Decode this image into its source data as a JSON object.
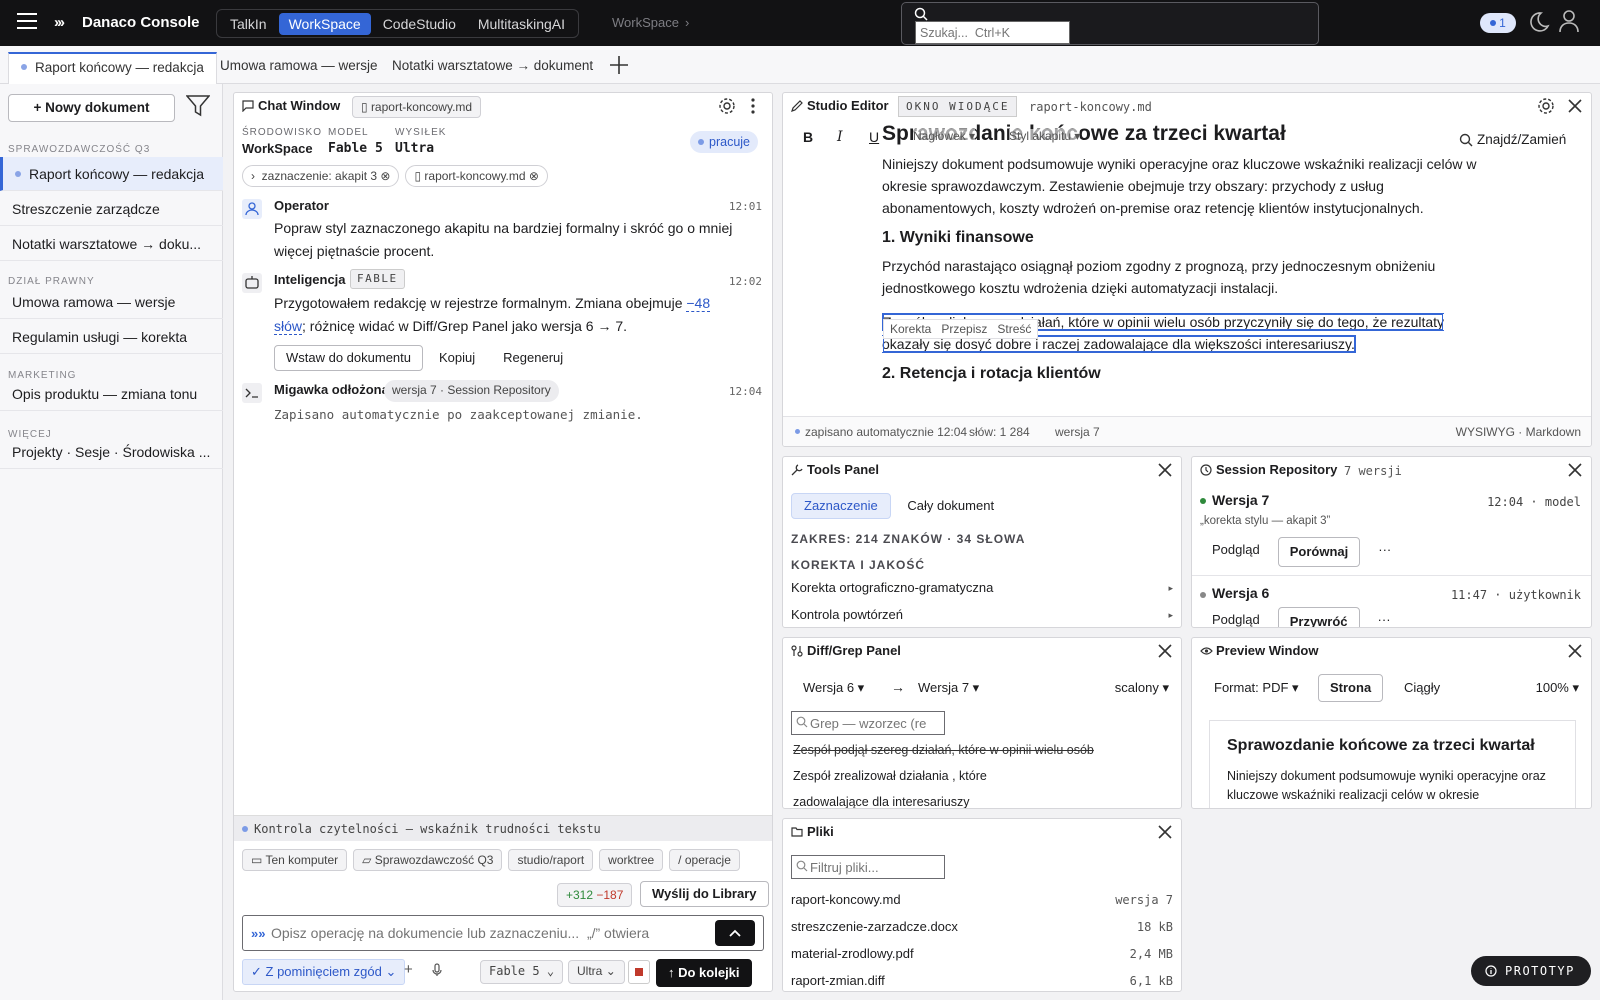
{
  "topbar": {
    "brand": "Danaco Console",
    "apps": [
      "TalkIn",
      "WorkSpace",
      "CodeStudio",
      "MultitaskingAI"
    ],
    "breadcrumb": "WorkSpace",
    "search_placeholder": "Szukaj...  Ctrl+K",
    "notif_count": "1"
  },
  "doc_tabs": [
    "Raport końcowy — redakcja",
    "Umowa ramowa — wersje",
    "Notatki warsztatowe → dokument"
  ],
  "sidebar": {
    "new_doc": "+ Nowy dokument",
    "sections": [
      {
        "title": "SPRAWOZDAWCZOŚĆ Q3",
        "items": [
          "Raport końcowy — redakcja",
          "Streszczenie zarządcze",
          "Notatki warsztatowe → doku..."
        ]
      },
      {
        "title": "DZIAŁ PRAWNY",
        "items": [
          "Umowa ramowa — wersje",
          "Regulamin usługi — korekta"
        ]
      },
      {
        "title": "MARKETING",
        "items": [
          "Opis produktu — zmiana tonu"
        ]
      },
      {
        "title": "WIĘCEJ",
        "items": [
          "Projekty · Sesje · Środowiska ..."
        ]
      }
    ]
  },
  "chat": {
    "title": "Chat Window",
    "file_chip": "raport-koncowy.md",
    "ctx": {
      "env_label": "ŚRODOWISKO",
      "env": "WorkSpace",
      "model_label": "MODEL",
      "model": "Fable 5",
      "effort_label": "WYSIŁEK",
      "effort": "Ultra"
    },
    "status": "pracuje",
    "context_chips": [
      "zaznaczenie: akapit 3",
      "raport-koncowy.md"
    ],
    "messages": [
      {
        "author": "Operator",
        "time": "12:01",
        "body": "Popraw styl zaznaczonego akapitu na bardziej formalny i skróć go o mniej więcej piętnaście procent."
      },
      {
        "author": "Inteligencja",
        "tag": "FABLE",
        "time": "12:02",
        "body_pre": "Przygotowałem redakcję w rejestrze formalnym. Zmiana obejmuje ",
        "body_link": "−48 słów",
        "body_post": "; różnicę widać w Diff/Grep Panel jako wersja 6 → 7."
      },
      {
        "author": "Migawka odłożona",
        "tag": "wersja 7 · Session Repository",
        "time": "12:04",
        "body": "Zapisano automatycznie po zaakceptowanej zmianie."
      }
    ],
    "actions": [
      "Wstaw do dokumentu",
      "Kopiuj",
      "Regeneruj"
    ],
    "readability": "Kontrola czytelności — wskaźnik trudności tekstu",
    "scope_chips": [
      "Ten komputer",
      "Sprawozdawczość Q3",
      "studio/raport",
      "worktree",
      "/ operacje"
    ],
    "diff_add": "+312",
    "diff_del": "−187",
    "send_library": "Wyślij do Library",
    "input_placeholder": "Opisz operację na dokumencie lub zaznaczeniu...  „/” otwiera",
    "consent": "Z pominięciem zgód",
    "model_select": "Fable 5",
    "effort_select": "Ultra",
    "queue": "↑ Do kolejki"
  },
  "editor": {
    "title": "Studio Editor",
    "mode": "OKNO WIODĄCE",
    "file": "raport-koncowy.md",
    "toolbar": {
      "heading": "Nagłówek",
      "style": "Styl akapitu",
      "find": "Znajdź/Zamień"
    },
    "h1": "Sprawozdanie końcowe za trzeci kwartał",
    "p1": "Niniejszy dokument podsumowuje wyniki operacyjne oraz kluczowe wskaźniki realizacji celów w okresie sprawozdawczym. Zestawienie obejmuje trzy obszary: przychody z usług abonamentowych, koszty wdrożeń on-premise oraz retencję klientów instytucjonalnych.",
    "h2": "1. Wyniki finansowe",
    "p2": "Przychód narastająco osiągnął poziom zgodny z prognozą, przy jednoczesnym obniżeniu jednostkowego kosztu wdrożenia dzięki automatyzacji instalacji.",
    "popup": [
      "Korekta",
      "Przepisz",
      "Streść"
    ],
    "p3": "Zespół podjął szereg działań, które w opinii wielu osób przyczyniły się do tego, że rezultaty okazały się dosyć dobre i raczej zadowalające dla większości interesariuszy.",
    "h2b": "2. Retencja i rotacja klientów",
    "foot": {
      "saved": "zapisano automatycznie 12:04",
      "words": "słów: 1 284",
      "version": "wersja 7",
      "mode": "WYSIWYG · Markdown"
    }
  },
  "tools": {
    "title": "Tools Panel",
    "seg": [
      "Zaznaczenie",
      "Cały dokument"
    ],
    "scope": "ZAKRES: 214 ZNAKÓW · 34 SŁOWA",
    "section": "KOREKTA I JAKOŚĆ",
    "rows": [
      "Korekta ortograficzno-gramatyczna",
      "Kontrola powtórzeń"
    ]
  },
  "repo": {
    "title": "Session Repository",
    "count": "7 wersji",
    "versions": [
      {
        "name": "Wersja 7",
        "meta": "12:04 · model",
        "note": "„korekta stylu — akapit 3”",
        "actions": [
          "Podgląd",
          "Porównaj",
          "···"
        ]
      },
      {
        "name": "Wersja 6",
        "meta": "11:47 · użytkownik",
        "actions": [
          "Podgląd",
          "Przywróć",
          "···"
        ]
      }
    ]
  },
  "diff": {
    "title": "Diff/Grep Panel",
    "from": "Wersja 6 ▾",
    "arrow": "→",
    "to": "Wersja 7 ▾",
    "mode": "scalony ▾",
    "grep_placeholder": "Grep — wzorzec (regex)",
    "lines": [
      "Zespół podjął szereg działań, które w opinii wielu osób",
      "Zespół zrealizował działania , które",
      "zadowalające dla interesariuszy"
    ]
  },
  "preview": {
    "title": "Preview Window",
    "format": "Format: PDF ▾",
    "seg": [
      "Strona",
      "Ciągły"
    ],
    "zoom": "100% ▾",
    "h": "Sprawozdanie końcowe za trzeci kwartał",
    "p": "Niniejszy dokument podsumowuje wyniki operacyjne oraz kluczowe wskaźniki realizacji celów w okresie"
  },
  "files": {
    "title": "Pliki",
    "filter_placeholder": "Filtruj pliki...",
    "rows": [
      {
        "name": "raport-koncowy.md",
        "meta": "wersja 7"
      },
      {
        "name": "streszczenie-zarzadcze.docx",
        "meta": "18 kB"
      },
      {
        "name": "material-zrodlowy.pdf",
        "meta": "2,4 MB"
      },
      {
        "name": "raport-zmian.diff",
        "meta": "6,1 kB"
      }
    ]
  },
  "prototype": "PROTOTYP",
  "colors": {
    "accent": "#3466d6",
    "topbar": "#121214",
    "add": "#2f8a3c",
    "del": "#c0392b"
  }
}
